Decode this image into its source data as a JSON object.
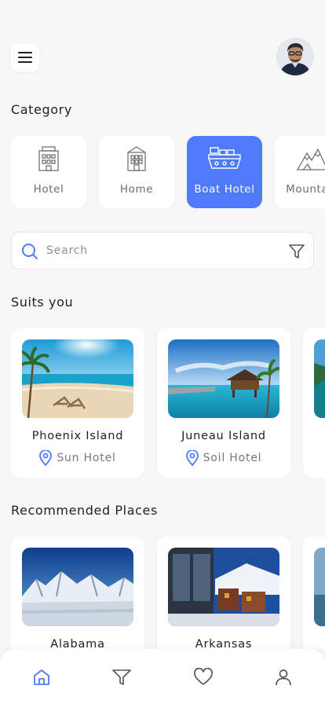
{
  "header": {
    "menu_icon": "hamburger-menu-icon",
    "avatar": "user-avatar"
  },
  "category": {
    "title": "Category",
    "items": [
      {
        "label": "Hotel",
        "icon": "hotel-building-icon",
        "active": false
      },
      {
        "label": "Home",
        "icon": "home-building-icon",
        "active": false
      },
      {
        "label": "Boat Hotel",
        "icon": "boat-hotel-icon",
        "active": true
      },
      {
        "label": "Mountain",
        "icon": "mountain-icon",
        "active": false
      }
    ]
  },
  "search": {
    "placeholder": "Search",
    "value": "",
    "icon": "search-icon",
    "filter_icon": "filter-icon"
  },
  "suits_you": {
    "title": "Suits you",
    "cards": [
      {
        "name": "Phoenix Island",
        "location": "Sun Hotel",
        "image": "beach-with-lounge-chairs"
      },
      {
        "name": "Juneau Island",
        "location": "Soil Hotel",
        "image": "overwater-bungalow"
      }
    ]
  },
  "recommended": {
    "title": "Recommended Places",
    "cards": [
      {
        "name": "Alabama",
        "image": "snowy-mountains-lake"
      },
      {
        "name": "Arkansas",
        "image": "snowy-village"
      }
    ]
  },
  "tabbar": {
    "items": [
      {
        "icon": "home-icon",
        "active": true
      },
      {
        "icon": "filter-icon",
        "active": false
      },
      {
        "icon": "heart-icon",
        "active": false
      },
      {
        "icon": "user-icon",
        "active": false
      }
    ]
  },
  "colors": {
    "accent": "#4f7bfa",
    "background": "#f7f7f8",
    "text": "#1f1f24",
    "muted": "#77777f"
  }
}
